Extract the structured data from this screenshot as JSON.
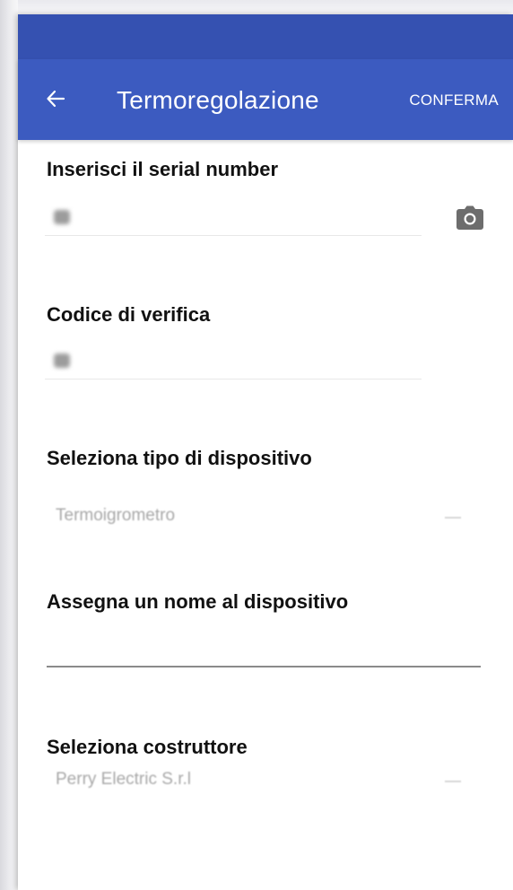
{
  "colors": {
    "status_bar": "#3551b1",
    "app_bar": "#3c5bc0",
    "label_text": "#111111",
    "hint_text": "#a8a8a8"
  },
  "app_bar": {
    "back_icon": "arrow-left-icon",
    "title": "Termoregolazione",
    "confirm_label": "CONFERMA"
  },
  "form": {
    "serial": {
      "label": "Inserisci il serial number",
      "camera_icon": "camera-icon"
    },
    "verification": {
      "label": "Codice di verifica"
    },
    "device_type": {
      "label": "Seleziona tipo di dispositivo",
      "value": "Termoigrometro"
    },
    "device_name": {
      "label": "Assegna un nome al dispositivo",
      "value": ""
    },
    "manufacturer": {
      "label": "Seleziona costruttore",
      "value": "Perry Electric S.r.l"
    }
  }
}
